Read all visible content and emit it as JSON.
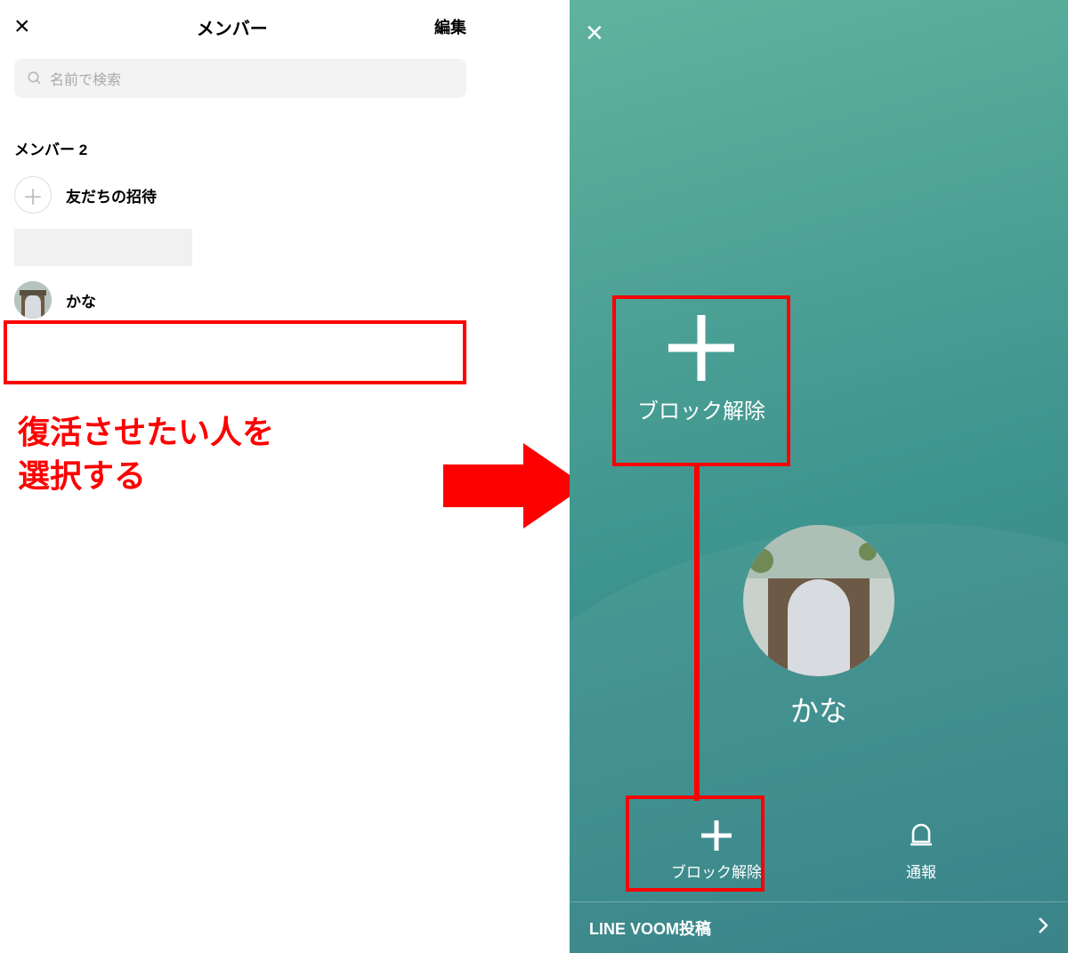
{
  "left": {
    "title": "メンバー",
    "edit": "編集",
    "search_placeholder": "名前で検索",
    "section_label": "メンバー 2",
    "invite_label": "友だちの招待",
    "member_name": "かな"
  },
  "annotation": {
    "text": "復活させたい人を\n選択する"
  },
  "right": {
    "unblock_big": "ブロック解除",
    "profile_name": "かな",
    "action_unblock": "ブロック解除",
    "action_report": "通報",
    "voom": "LINE VOOM投稿"
  }
}
